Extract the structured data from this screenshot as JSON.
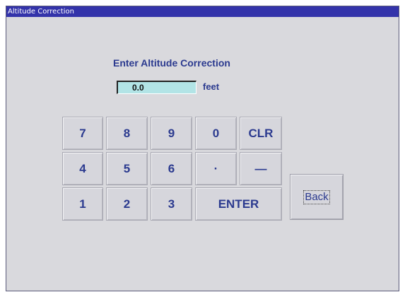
{
  "window": {
    "title": "Altitude Correction"
  },
  "prompt": {
    "heading": "Enter Altitude Correction"
  },
  "field": {
    "value": "0.0",
    "unit": "feet"
  },
  "keypad": {
    "k7": "7",
    "k8": "8",
    "k9": "9",
    "k0": "0",
    "clr": "CLR",
    "k4": "4",
    "k5": "5",
    "k6": "6",
    "dot": "·",
    "minus": "—",
    "k1": "1",
    "k2": "2",
    "k3": "3",
    "enter": "ENTER"
  },
  "back": {
    "label": "Back"
  },
  "colors": {
    "titlebar": "#3333aa",
    "panel": "#d9d9dd",
    "label_text": "#2b3a8f",
    "field_bg": "#b2e4e6"
  }
}
